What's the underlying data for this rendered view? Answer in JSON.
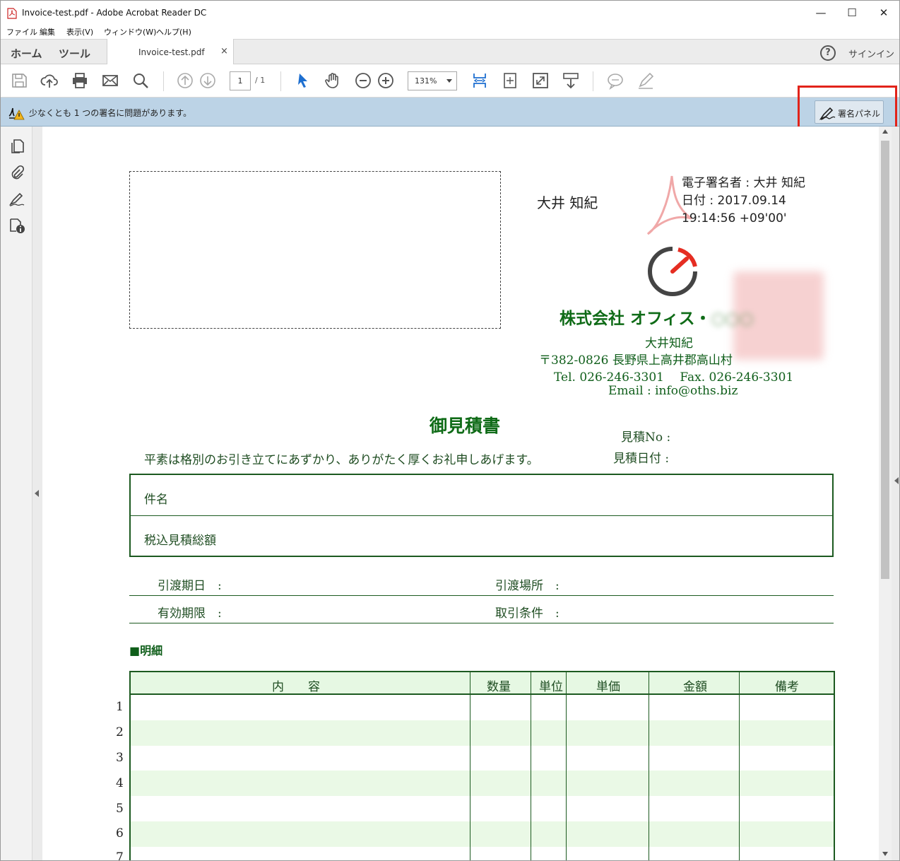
{
  "window": {
    "title": "Invoice-test.pdf - Adobe Acrobat Reader DC",
    "minimize": "—",
    "maximize": "☐",
    "close": "✕"
  },
  "menu": [
    "ファイル",
    "編集",
    "表示(V)",
    "ウィンドウ(W)",
    "ヘルプ(H)"
  ],
  "tabs": {
    "home": "ホーム",
    "tools": "ツール",
    "document": "Invoice-test.pdf",
    "close_tab": "×",
    "help": "?",
    "signin": "サインイン"
  },
  "toolbar": {
    "icons": [
      "save-icon",
      "upload-icon",
      "print-icon",
      "email-icon",
      "search-icon",
      "prev-page-icon",
      "next-page-icon",
      "select-arrow-icon",
      "hand-tool-icon",
      "zoom-out-icon",
      "zoom-in-icon",
      "fit-page-icon",
      "fit-width-icon",
      "fullscreen-icon",
      "read-mode-icon",
      "comment-icon",
      "pen-icon"
    ],
    "page_current": "1",
    "page_total": "/ 1",
    "zoom": "131%"
  },
  "infobar": {
    "message": "少なくとも 1 つの署名に問題があります。",
    "signature_panel_button": "署名パネル"
  },
  "document": {
    "signer_name": "大井 知紀",
    "signature_lines": [
      "電子署名者 : 大井 知紀",
      "日付 : 2017.09.14",
      "19:14:56 +09'00'"
    ],
    "company_name": "株式会社 オフィス・",
    "company_name_blurred": "○○○",
    "contact_person": "大井知紀",
    "address": "〒382-0826 長野県上高井郡高山村",
    "phone_fax": "Tel. 026-246-3301　 Fax. 026-246-3301",
    "email": "Email : info@oths.biz",
    "doc_title": "御見積書",
    "estimate_no_label": "見積No :",
    "estimate_date_label": "見積日付 :",
    "greeting": "平素は格別のお引き立てにあずかり、ありがたく厚くお礼申しあげます。",
    "subject_label": "件名",
    "total_label": "税込見積総額",
    "delivery_date_label": "引渡期日　:",
    "delivery_place_label": "引渡場所　:",
    "validity_label": "有効期限　:",
    "trade_terms_label": "取引条件　:",
    "detail_heading": "■明細",
    "table_headers": [
      "内　　容",
      "数量",
      "単位",
      "単価",
      "金額",
      "備考"
    ],
    "row_numbers": [
      "1",
      "2",
      "3",
      "4",
      "5",
      "6",
      "7"
    ]
  }
}
